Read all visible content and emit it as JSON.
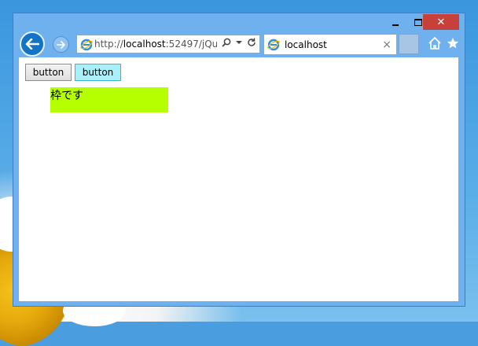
{
  "window": {
    "minimize_glyph": "",
    "close_glyph": "✕"
  },
  "navigation": {
    "address_scheme": "http://",
    "address_host": "localhost",
    "address_rest": ":52497/jQu"
  },
  "tab": {
    "title": "localhost",
    "close_glyph": "×"
  },
  "page": {
    "button1_label": "button",
    "button2_label": "button",
    "frame_text": "枠です"
  },
  "colors": {
    "frame_bg": "#b5ff00",
    "button2_bg": "#aaf0fb",
    "close_btn": "#c7403a",
    "chrome": "#6fb0ef"
  }
}
